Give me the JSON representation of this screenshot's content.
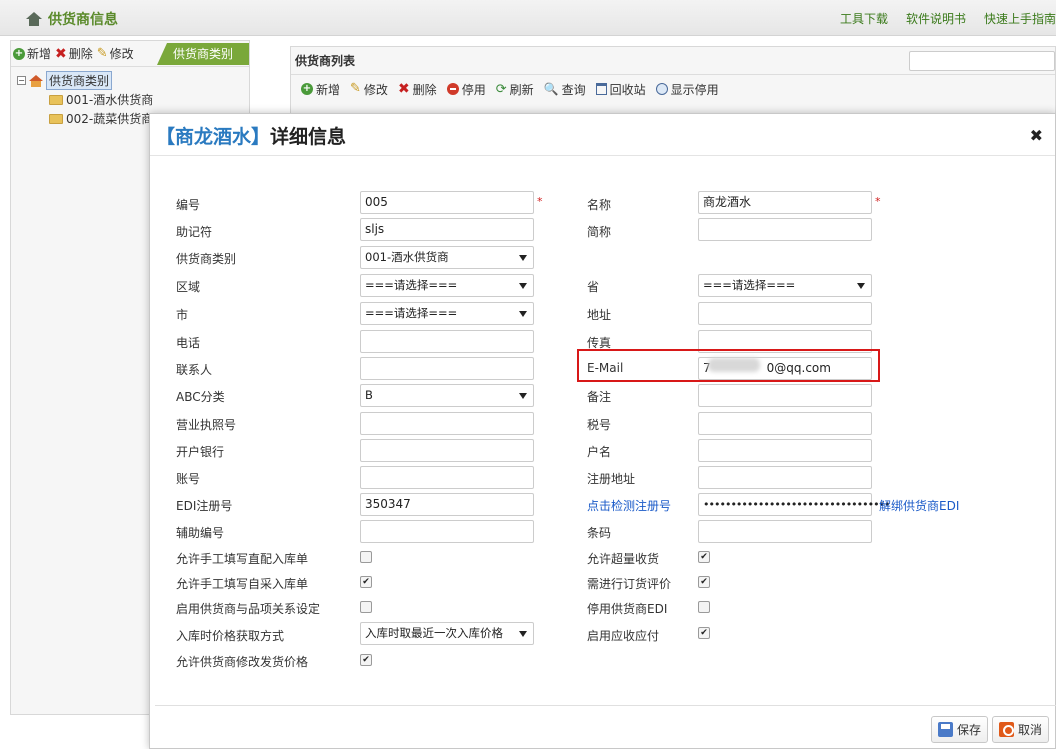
{
  "header": {
    "title": "供货商信息",
    "links": [
      "工具下载",
      "软件说明书",
      "快速上手指南"
    ]
  },
  "left_panel": {
    "toolbar": {
      "add": "新增",
      "delete": "删除",
      "edit": "修改"
    },
    "tab": "供货商类别",
    "tree": {
      "root": "供货商类别",
      "root_toggle": "−",
      "children": [
        "001-酒水供货商",
        "002-蔬菜供货商"
      ]
    }
  },
  "right_panel": {
    "title": "供货商列表",
    "toolbar": {
      "add": "新增",
      "edit": "修改",
      "delete": "删除",
      "disable": "停用",
      "refresh": "刷新",
      "query": "查询",
      "recycle": "回收站",
      "show_disabled": "显示停用"
    }
  },
  "dialog": {
    "title_name": "【商龙酒水】",
    "title_suffix": "详细信息",
    "close": "✖",
    "labels": {
      "code": "编号",
      "name": "名称",
      "mnemonic": "助记符",
      "short_name": "简称",
      "category": "供货商类别",
      "region": "区域",
      "province": "省",
      "city": "市",
      "address": "地址",
      "phone": "电话",
      "fax": "传真",
      "contact": "联系人",
      "email": "E-Mail",
      "abc": "ABC分类",
      "remark": "备注",
      "license": "营业执照号",
      "tax_no": "税号",
      "bank": "开户银行",
      "account_name": "户名",
      "account_no": "账号",
      "reg_address": "注册地址",
      "edi_no": "EDI注册号",
      "check_reg": "点击检测注册号",
      "unbind_edi": "解绑供货商EDI",
      "aux_code": "辅助编号",
      "barcode": "条码",
      "allow_direct_in": "允许手工填写直配入库单",
      "allow_over_receive": "允许超量收货",
      "allow_self_in": "允许手工填写自采入库单",
      "need_eval": "需进行订货评价",
      "enable_item_rel": "启用供货商与品项关系设定",
      "disable_edi": "停用供货商EDI",
      "price_method": "入库时价格获取方式",
      "enable_ap": "启用应收应付",
      "allow_modify_price": "允许供货商修改发货价格"
    },
    "values": {
      "code": "005",
      "name": "商龙酒水",
      "mnemonic": "sljs",
      "short_name": "",
      "category": "001-酒水供货商",
      "region": "===请选择===",
      "province": "===请选择===",
      "city": "===请选择===",
      "address": "",
      "phone": "",
      "fax": "",
      "contact": "",
      "email_prefix": "7",
      "email_suffix": "0@qq.com",
      "abc": "B",
      "remark": "",
      "license": "",
      "tax_no": "",
      "bank": "",
      "account_name": "",
      "account_no": "",
      "reg_address": "",
      "edi_no": "350347",
      "edi_password": "••••••••••••••••••••••••••••••••••",
      "aux_code": "",
      "barcode": "",
      "price_method": "入库时取最近一次入库价格"
    },
    "required_mark": "*",
    "checkboxes": {
      "allow_direct_in": false,
      "allow_over_receive": true,
      "allow_self_in": true,
      "need_eval": true,
      "enable_item_rel": false,
      "disable_edi": false,
      "enable_ap": true,
      "allow_modify_price": true
    },
    "footer": {
      "save": "保存",
      "cancel": "取消"
    }
  }
}
